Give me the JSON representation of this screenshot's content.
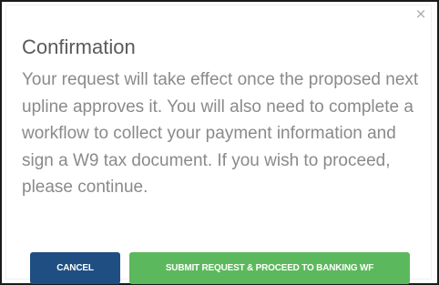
{
  "dialog": {
    "close_glyph": "×",
    "title": "Confirmation",
    "message": "Your request will take effect once the proposed next upline approves it. You will also need to complete a workflow to collect your payment information and sign a W9 tax document. If you wish to proceed, please continue."
  },
  "actions": {
    "cancel_label": "CANCEL",
    "submit_label": "SUBMIT REQUEST & PROCEED TO BANKING WF"
  },
  "colors": {
    "cancel_button": "#1f4f82",
    "submit_button": "#5cb85c",
    "title_text": "#5a5a5a",
    "body_text": "#8a8a8a"
  }
}
